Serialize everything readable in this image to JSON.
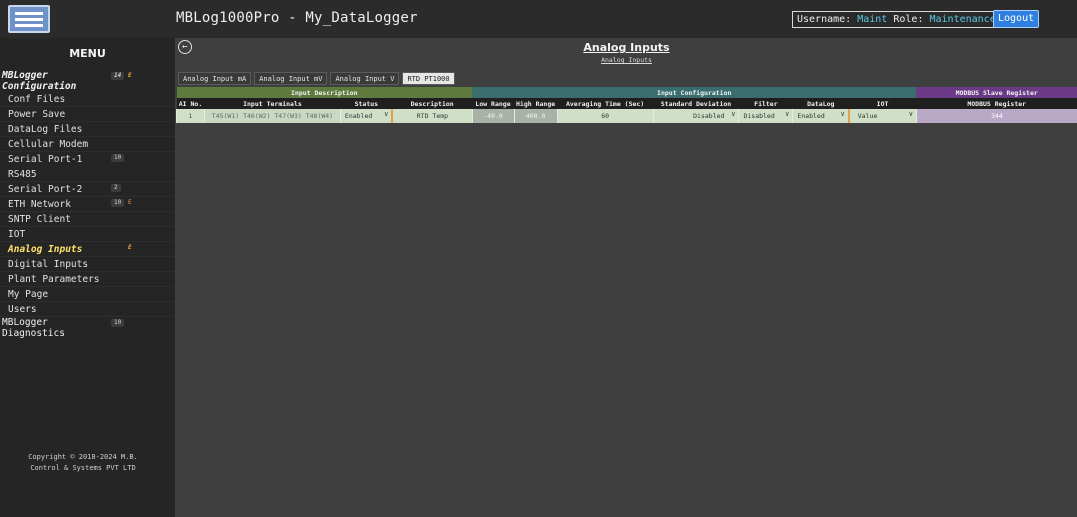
{
  "header": {
    "app_title": "MBLog1000Pro - My_DataLogger",
    "username_label": "Username:",
    "username": "Maint",
    "role_label": "Role:",
    "role": "Maintenance",
    "logout_label": "Logout"
  },
  "sidebar": {
    "menu_title": "MENU",
    "config_group": {
      "line1": "MBLogger",
      "line2": "Configuration",
      "count": "14",
      "flag": "E"
    },
    "items": [
      {
        "label": "Conf Files"
      },
      {
        "label": "Power Save"
      },
      {
        "label": "DataLog Files"
      },
      {
        "label": "Cellular Modem"
      },
      {
        "label_line1": "Serial Port-1",
        "label_line2": "RS485",
        "count": "10"
      },
      {
        "label": "Serial Port-2",
        "count": "2"
      },
      {
        "label": "ETH Network",
        "count": "10",
        "flag": "E"
      },
      {
        "label": "SNTP Client"
      },
      {
        "label": "IOT"
      },
      {
        "label": "Analog Inputs",
        "flag": "E"
      },
      {
        "label": "Digital Inputs"
      },
      {
        "label": "Plant Parameters"
      },
      {
        "label": "My Page"
      },
      {
        "label": "Users"
      }
    ],
    "diagnostics_group": {
      "line1": "MBLogger",
      "line2": "Diagnostics",
      "count": "10"
    },
    "copyright_line1": "Copyright © 2018-2024 M.B.",
    "copyright_line2": "Control & Systems PVT LTD"
  },
  "main": {
    "back_icon": "back-arrow-icon",
    "title": "Analog Inputs",
    "subtitle": "Analog Inputs",
    "tabs": [
      {
        "label": "Analog Input mA"
      },
      {
        "label": "Analog Input mV"
      },
      {
        "label": "Analog Input V"
      },
      {
        "label": "RTD PT1000"
      }
    ],
    "active_tab": "RTD PT1000",
    "table": {
      "group_headers": {
        "input_description": "Input Description",
        "input_configuration": "Input Configuration",
        "modbus_slave": "MODBUS Slave Register"
      },
      "columns": {
        "ai_no": "AI No.",
        "terminals": "Input Terminals",
        "status": "Status",
        "description": "Description",
        "low_range": "Low Range",
        "high_range": "High Range",
        "averaging_time": "Averaging Time (Sec)",
        "std_dev": "Standard Deviation",
        "filter": "Filter",
        "datalog": "DataLog",
        "iot": "IOT",
        "modbus_register": "MODBUS Register"
      },
      "rows": [
        {
          "ai_no": "1",
          "terminals": "T45(W1) T46(W2) T47(W3) T48(W4)",
          "status": "Enabled",
          "description": "RTD Temp",
          "low_range": "-40.0",
          "high_range": "400.0",
          "averaging_time": "60",
          "std_dev": "Disabled",
          "filter": "Disabled",
          "datalog": "Enabled",
          "iot": "Value",
          "modbus_register": "344"
        }
      ]
    }
  },
  "colors": {
    "background": "#3f3f3f",
    "sidebar": "#252525",
    "accent": "#2f7fe0",
    "input_desc_header": "#5e7a3d",
    "input_config_header": "#3a6e6e",
    "modbus_header": "#6a3a86",
    "active_item": "#ffe26a"
  }
}
